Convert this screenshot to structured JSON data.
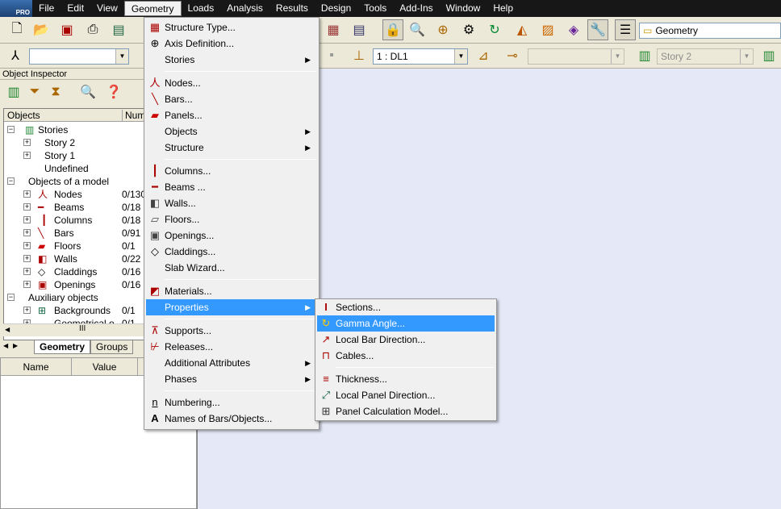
{
  "app": {
    "logo_text": "PRO"
  },
  "menubar": {
    "items": [
      "File",
      "Edit",
      "View",
      "Geometry",
      "Loads",
      "Analysis",
      "Results",
      "Design",
      "Tools",
      "Add-Ins",
      "Window",
      "Help"
    ],
    "active_index": 3
  },
  "toolbar": {
    "layout_combo": "Geometry",
    "load_case_combo": "1 : DL1",
    "story_combo": "Story 2"
  },
  "inspector": {
    "title": "Object Inspector",
    "columns": [
      "Objects",
      "Numb"
    ],
    "tree": [
      {
        "label": "Stories",
        "value": ""
      },
      {
        "label": "Story 2",
        "value": ""
      },
      {
        "label": "Story 1",
        "value": ""
      },
      {
        "label": "Undefined",
        "value": ""
      },
      {
        "label": "Objects of a model",
        "value": ""
      },
      {
        "label": "Nodes",
        "value": "0/130"
      },
      {
        "label": "Beams",
        "value": "0/18"
      },
      {
        "label": "Columns",
        "value": "0/18"
      },
      {
        "label": "Bars",
        "value": "0/91"
      },
      {
        "label": "Floors",
        "value": "0/1"
      },
      {
        "label": "Walls",
        "value": "0/22"
      },
      {
        "label": "Claddings",
        "value": "0/16"
      },
      {
        "label": "Openings",
        "value": "0/16"
      },
      {
        "label": "Auxiliary objects",
        "value": ""
      },
      {
        "label": "Backgrounds",
        "value": "0/1"
      },
      {
        "label": "Geometrical o...",
        "value": "0/1"
      }
    ],
    "scroll_marker": "III",
    "tabs": [
      "Geometry",
      "Groups"
    ],
    "props_columns": [
      "Name",
      "Value"
    ]
  },
  "geometry_menu": {
    "items": [
      {
        "label": "Structure Type...",
        "icon": "structure-type-icon",
        "glyph": "▦"
      },
      {
        "label": "Axis Definition...",
        "icon": "axis-definition-icon",
        "glyph": "⊕"
      },
      {
        "label": "Stories",
        "icon": "",
        "glyph": "",
        "submenu": true
      },
      {
        "label": "Nodes...",
        "icon": "nodes-icon",
        "glyph": "人"
      },
      {
        "label": "Bars...",
        "icon": "bars-icon",
        "glyph": "╲"
      },
      {
        "label": "Panels...",
        "icon": "panels-icon",
        "glyph": "▰"
      },
      {
        "label": "Objects",
        "icon": "",
        "glyph": "",
        "submenu": true
      },
      {
        "label": "Structure",
        "icon": "",
        "glyph": "",
        "submenu": true
      },
      {
        "label": "Columns...",
        "icon": "columns-icon",
        "glyph": "┃"
      },
      {
        "label": "Beams ...",
        "icon": "beams-icon",
        "glyph": "━"
      },
      {
        "label": "Walls...",
        "icon": "walls-icon",
        "glyph": "◧"
      },
      {
        "label": "Floors...",
        "icon": "floors-icon",
        "glyph": "▱"
      },
      {
        "label": "Openings...",
        "icon": "openings-icon",
        "glyph": "▣"
      },
      {
        "label": "Claddings...",
        "icon": "claddings-icon",
        "glyph": "◇"
      },
      {
        "label": "Slab Wizard...",
        "icon": "",
        "glyph": ""
      },
      {
        "label": "Materials...",
        "icon": "materials-icon",
        "glyph": "◩"
      },
      {
        "label": "Properties",
        "icon": "",
        "glyph": "",
        "submenu": true
      },
      {
        "label": "Supports...",
        "icon": "supports-icon",
        "glyph": "⊼"
      },
      {
        "label": "Releases...",
        "icon": "releases-icon",
        "glyph": "⊬"
      },
      {
        "label": "Additional Attributes",
        "icon": "",
        "glyph": "",
        "submenu": true
      },
      {
        "label": "Phases",
        "icon": "",
        "glyph": "",
        "submenu": true
      },
      {
        "label": "Numbering...",
        "icon": "numbering-icon",
        "glyph": "n"
      },
      {
        "label": "Names of Bars/Objects...",
        "icon": "names-icon",
        "glyph": "A"
      }
    ],
    "highlighted_index": 16
  },
  "properties_submenu": {
    "items": [
      {
        "label": "Sections...",
        "icon": "sections-icon",
        "glyph": "Ι"
      },
      {
        "label": "Gamma Angle...",
        "icon": "gamma-angle-icon",
        "glyph": "↻"
      },
      {
        "label": "Local Bar Direction...",
        "icon": "local-bar-direction-icon",
        "glyph": "↗"
      },
      {
        "label": "Cables...",
        "icon": "cables-icon",
        "glyph": "⊓"
      },
      {
        "label": "Thickness...",
        "icon": "thickness-icon",
        "glyph": "≡"
      },
      {
        "label": "Local Panel Direction...",
        "icon": "local-panel-direction-icon",
        "glyph": "⤢"
      },
      {
        "label": "Panel Calculation Model...",
        "icon": "panel-calculation-model-icon",
        "glyph": "⊞"
      }
    ],
    "highlighted_index": 1
  },
  "colors": {
    "menubar": "#171717",
    "highlight": "#3399ff",
    "workspace": "#e5e9f7",
    "toolbar": "#ece9d8"
  }
}
